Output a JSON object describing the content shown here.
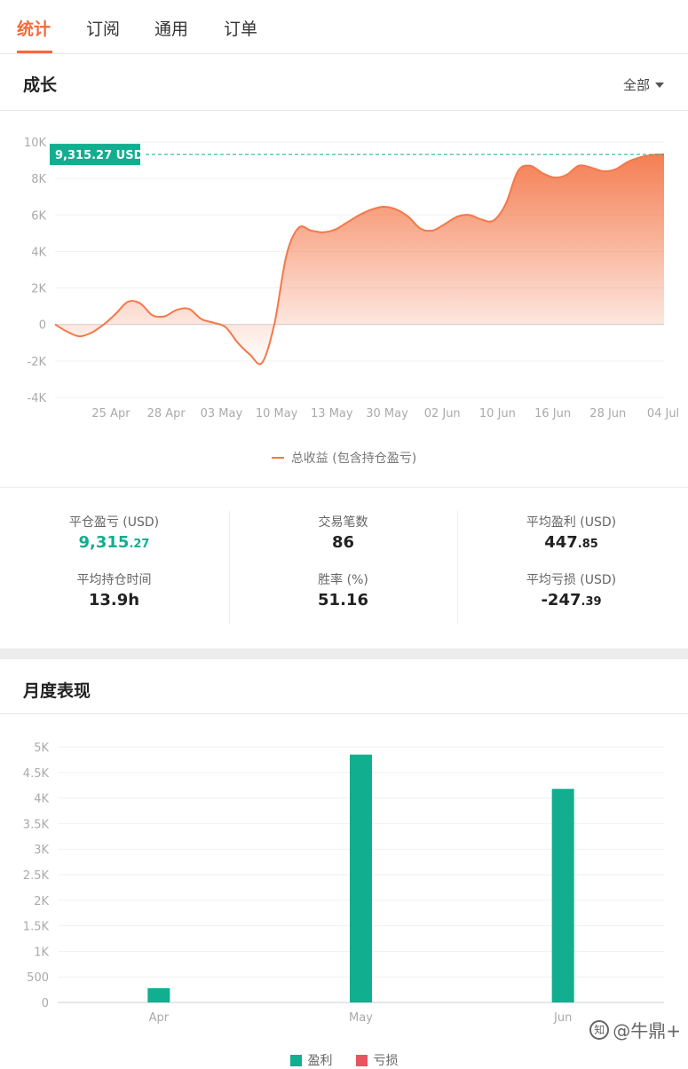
{
  "tabs": [
    {
      "label": "统计",
      "active": true
    },
    {
      "label": "订阅",
      "active": false
    },
    {
      "label": "通用",
      "active": false
    },
    {
      "label": "订单",
      "active": false
    }
  ],
  "growth": {
    "title": "成长",
    "filter_label": "全部",
    "badge_label": "9,315.27 USD",
    "legend_label": "总收益 (包含持仓盈亏)",
    "colors": {
      "line": "#f4784a",
      "badge": "#11ae8f"
    }
  },
  "stats": {
    "closed_pnl_label": "平仓盈亏 (USD)",
    "closed_pnl_int": "9,315",
    "closed_pnl_dec": ".27",
    "trades_label": "交易笔数",
    "trades_value": "86",
    "avg_profit_label": "平均盈利 (USD)",
    "avg_profit_int": "447",
    "avg_profit_dec": ".85",
    "avg_hold_label": "平均持仓时间",
    "avg_hold_value": "13.9h",
    "win_rate_label": "胜率 (%)",
    "win_rate_value": "51.16",
    "avg_loss_label": "平均亏损 (USD)",
    "avg_loss_int": "-247",
    "avg_loss_dec": ".39"
  },
  "monthly": {
    "title": "月度表现",
    "legend": [
      {
        "label": "盈利",
        "color": "#11ae8f"
      },
      {
        "label": "亏损",
        "color": "#e8555e"
      }
    ]
  },
  "watermark": "@牛鼎+",
  "chart_data": [
    {
      "type": "area",
      "title": "成长",
      "x_ticks": [
        "25 Apr",
        "28 Apr",
        "03 May",
        "10 May",
        "13 May",
        "30 May",
        "02 Jun",
        "10 Jun",
        "16 Jun",
        "28 Jun",
        "04 Jul"
      ],
      "y_ticks": [
        "10K",
        "8K",
        "6K",
        "4K",
        "2K",
        "0",
        "-2K",
        "-4K"
      ],
      "ylim": [
        -4000,
        10000
      ],
      "reference_value": 9315.27,
      "series": [
        {
          "name": "总收益 (包含持仓盈亏)",
          "values": [
            0,
            -400,
            -650,
            -450,
            0,
            600,
            1250,
            1150,
            500,
            450,
            800,
            850,
            300,
            100,
            -150,
            -1000,
            -1650,
            -2100,
            0,
            3800,
            5300,
            5150,
            5050,
            5200,
            5600,
            6000,
            6300,
            6450,
            6300,
            5900,
            5250,
            5150,
            5500,
            5900,
            6000,
            5750,
            5700,
            6600,
            8400,
            8700,
            8300,
            8050,
            8200,
            8700,
            8600,
            8400,
            8500,
            8900,
            9150,
            9280,
            9315
          ]
        }
      ]
    },
    {
      "type": "bar",
      "title": "月度表现",
      "categories": [
        "Apr",
        "May",
        "Jun"
      ],
      "y_ticks": [
        "5K",
        "4.5K",
        "4K",
        "3.5K",
        "3K",
        "2.5K",
        "2K",
        "1.5K",
        "1K",
        "500",
        "0"
      ],
      "ylim": [
        0,
        5000
      ],
      "series": [
        {
          "name": "盈利",
          "values": [
            280,
            4850,
            4180
          ]
        },
        {
          "name": "亏损",
          "values": [
            0,
            0,
            0
          ]
        }
      ]
    }
  ]
}
